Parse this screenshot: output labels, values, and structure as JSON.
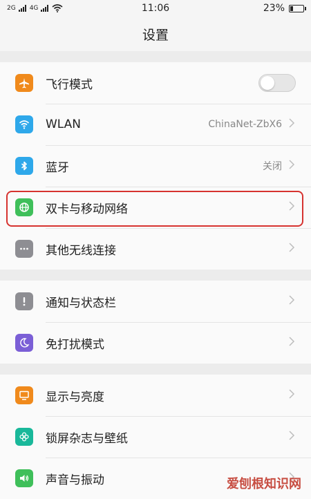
{
  "status": {
    "signal1": "2G",
    "signal2": "4G",
    "time": "11:06",
    "battery_text": "23%",
    "battery_level": 0.23
  },
  "header": {
    "title": "设置"
  },
  "groups": [
    {
      "items": [
        {
          "label": "飞行模式",
          "icon": "airplane-icon",
          "icon_color": "#f08a1c",
          "control": "toggle",
          "toggle_on": false
        },
        {
          "label": "WLAN",
          "icon": "wifi-icon",
          "icon_color": "#2ea8ea",
          "value": "ChinaNet-ZbX6"
        },
        {
          "label": "蓝牙",
          "icon": "bluetooth-icon",
          "icon_color": "#2ea8ea",
          "value": "关闭"
        },
        {
          "label": "双卡与移动网络",
          "icon": "globe-icon",
          "icon_color": "#3fbf5a",
          "value": ""
        },
        {
          "label": "其他无线连接",
          "icon": "more-dots-icon",
          "icon_color": "#8e8e93",
          "value": ""
        }
      ]
    },
    {
      "items": [
        {
          "label": "通知与状态栏",
          "icon": "exclamation-icon",
          "icon_color": "#8e8e93",
          "value": ""
        },
        {
          "label": "免打扰模式",
          "icon": "moon-icon",
          "icon_color": "#7b5fd6",
          "value": ""
        }
      ]
    },
    {
      "items": [
        {
          "label": "显示与亮度",
          "icon": "monitor-icon",
          "icon_color": "#f08a1c",
          "value": ""
        },
        {
          "label": "锁屏杂志与壁纸",
          "icon": "flower-icon",
          "icon_color": "#19b89a",
          "value": ""
        },
        {
          "label": "声音与振动",
          "icon": "speaker-icon",
          "icon_color": "#3fbf5a",
          "value": ""
        }
      ]
    }
  ],
  "watermark": "爱刨根知识网"
}
